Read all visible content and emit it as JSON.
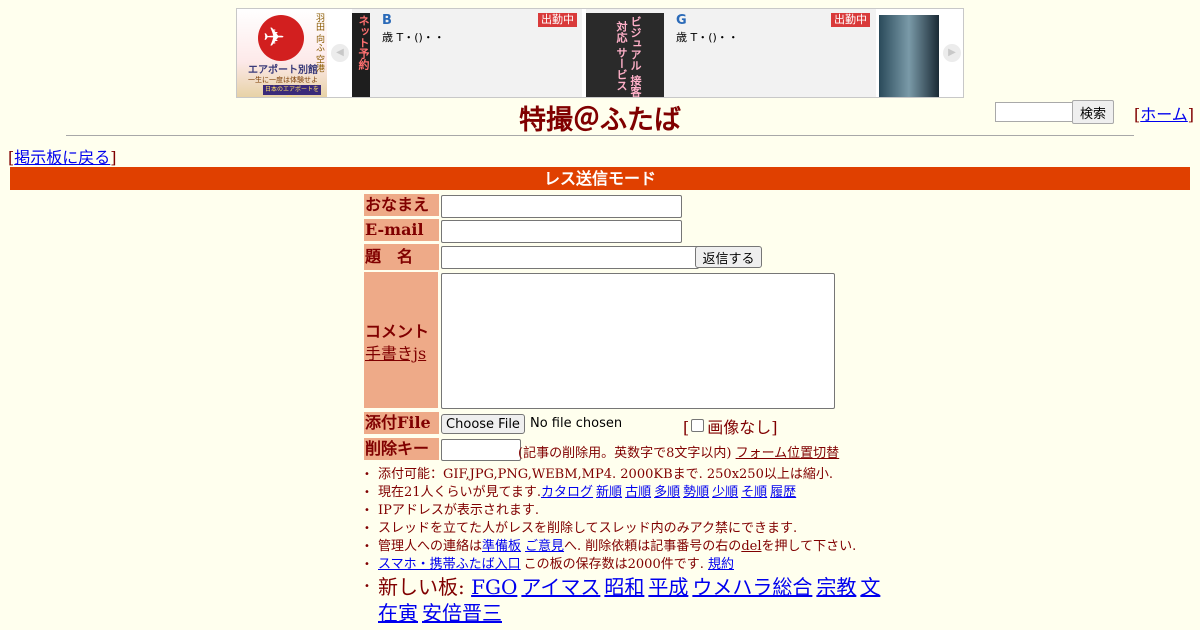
{
  "banner": {
    "logo_side_text": "羽田 向ふ 空港",
    "logo_text": "エアポート別館",
    "logo_sub": "一生に一度は体験せよ",
    "logo_strip": "日本のエアポートを超え",
    "card1": {
      "image_text": "ネット予約",
      "name": "B",
      "badge": "出勤中",
      "info": "歳 T・()・・"
    },
    "card2": {
      "image_text": "ビジュアル 接客 対応 サービス",
      "name": "G",
      "badge": "出勤中",
      "info": "歳 T・()・・"
    }
  },
  "header": {
    "site_title": "特撮＠ふたば",
    "search_button": "検索",
    "home_link": "ホーム"
  },
  "nav": {
    "back_link": "掲示板に戻る"
  },
  "mode_bar": "レス送信モード",
  "form": {
    "name_label": "おなまえ",
    "email_label": "E-mail",
    "subject_label": "題　名",
    "submit_button": "返信する",
    "comment_label": "コメント",
    "handwrite_link": "手書きjs",
    "file_label": "添付File",
    "choose_file_button": "Choose File",
    "no_file_text": "No file chosen",
    "no_image_label": "画像なし",
    "delete_key_label": "削除キー",
    "delete_key_note": "(記事の削除用。英数字で8文字以内)",
    "form_position_link": "フォーム位置切替"
  },
  "notes": {
    "line1": "添付可能：GIF,JPG,PNG,WEBM,MP4. 2000KBまで. 250x250以上は縮小.",
    "line2_prefix": "現在21人くらいが見てます.",
    "line2_links": [
      "カタログ",
      "新順",
      "古順",
      "多順",
      "勢順",
      "少順",
      "そ順",
      "履歴"
    ],
    "line3": "IPアドレスが表示されます.",
    "line4": "スレッドを立てた人がレスを削除してスレッド内のみアク禁にできます.",
    "line5_prefix": "管理人への連絡は",
    "line5_link1": "準備板",
    "line5_link2": "ご意見",
    "line5_middle": "へ. 削除依頼は記事番号の右の",
    "line5_del": "del",
    "line5_suffix": "を押して下さい.",
    "line6_link1": "スマホ・携帯ふたば入口",
    "line6_text": "この板の保存数は2000件です.",
    "line6_link2": "規約"
  },
  "boards": {
    "prefix": "新しい板:",
    "links": [
      "FGO",
      "アイマス",
      "昭和",
      "平成",
      "ウメハラ総合",
      "宗教",
      "文在寅",
      "安倍晋三"
    ]
  },
  "colors": {
    "background": "#ffffee",
    "text": "#800000",
    "mode_bar": "#e04000",
    "label_bg": "#eeaa88"
  }
}
